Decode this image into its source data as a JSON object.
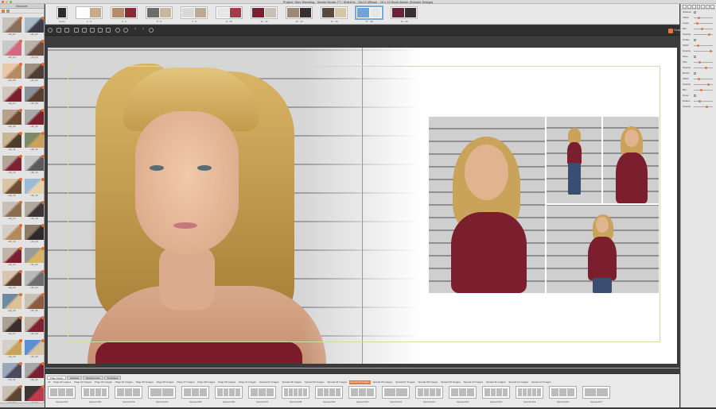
{
  "window": {
    "title": "Project: Wes Wedding - Senior Books TT / Shield A - 10x13 MBook - 10 x 10 Book Album (Sample Design)"
  },
  "browser": {
    "title": "Browser",
    "footer": "",
    "thumbs": [
      {
        "label": "Hill_01",
        "c1": "#c9c2bb",
        "c2": "#8a6e5a"
      },
      {
        "label": "Hill_02",
        "c1": "#a7b8c6",
        "c2": "#3d3b48"
      },
      {
        "label": "Hill_03",
        "c1": "#c8c8c8",
        "c2": "#d26a7f"
      },
      {
        "label": "Hill_04",
        "c1": "#b9b2a9",
        "c2": "#6a4c3e"
      },
      {
        "label": "Hill_05",
        "c1": "#e8c9ac",
        "c2": "#b78b62"
      },
      {
        "label": "Hill_06",
        "c1": "#9d8f82",
        "c2": "#4b3e36"
      },
      {
        "label": "Hill_07",
        "c1": "#cfc6bd",
        "c2": "#7b1f2e"
      },
      {
        "label": "Hill_08",
        "c1": "#8b8f99",
        "c2": "#5a3d2e"
      },
      {
        "label": "Hill_09",
        "c1": "#b6a18c",
        "c2": "#6b4a31"
      },
      {
        "label": "Hill_10",
        "c1": "#a8a8a8",
        "c2": "#7b1f2e"
      },
      {
        "label": "Hill_11",
        "c1": "#c9b496",
        "c2": "#4f3b2b"
      },
      {
        "label": "Hill_12",
        "c1": "#7c8a6a",
        "c2": "#c9a35a"
      },
      {
        "label": "Hill_13",
        "c1": "#b0a596",
        "c2": "#7d2233"
      },
      {
        "label": "Hill_14",
        "c1": "#c5c5c5",
        "c2": "#5b5b5b"
      },
      {
        "label": "Hill_15",
        "c1": "#d9c4a4",
        "c2": "#6d4d33"
      },
      {
        "label": "Hill_16",
        "c1": "#9cbbd9",
        "c2": "#e6d3a8"
      },
      {
        "label": "Hill_17",
        "c1": "#c7bfb5",
        "c2": "#8b6e4d"
      },
      {
        "label": "Hill_18",
        "c1": "#b2a99e",
        "c2": "#3d3436"
      },
      {
        "label": "Hill_19",
        "c1": "#d2cfc9",
        "c2": "#b48a5a"
      },
      {
        "label": "Hill_20",
        "c1": "#8c7a68",
        "c2": "#2f2a2a"
      },
      {
        "label": "Hill_21",
        "c1": "#c0b5a8",
        "c2": "#7b1f2e"
      },
      {
        "label": "Hill_22",
        "c1": "#9a9a9a",
        "c2": "#d8b466"
      },
      {
        "label": "Hill_23",
        "c1": "#d7c5ae",
        "c2": "#5e3b2c"
      },
      {
        "label": "Hill_24",
        "c1": "#b9b9b9",
        "c2": "#6d6d6d"
      },
      {
        "label": "Hill_25",
        "c1": "#6e8aa3",
        "c2": "#dcc292"
      },
      {
        "label": "Hill_26",
        "c1": "#c9c0b4",
        "c2": "#8a5c40"
      },
      {
        "label": "Hill_27",
        "c1": "#a9a194",
        "c2": "#3a2f2a"
      },
      {
        "label": "Hill_28",
        "c1": "#bfb3a4",
        "c2": "#7d2233"
      },
      {
        "label": "Hill_29",
        "c1": "#d4d0c8",
        "c2": "#c9a35a"
      },
      {
        "label": "Hill_30",
        "c1": "#5a8fd1",
        "c2": "#d9c3a0"
      },
      {
        "label": "Hill_31",
        "c1": "#9aa9b9",
        "c2": "#4a4a58"
      },
      {
        "label": "Hill_32",
        "c1": "#a7a7a7",
        "c2": "#7b1f2e"
      },
      {
        "label": "Hill_33",
        "c1": "#c9bfb1",
        "c2": "#5e4433"
      },
      {
        "label": "Hill_34",
        "c1": "#3d3436",
        "c2": "#c13a4a"
      }
    ]
  },
  "strip": {
    "spreads": [
      {
        "cap": "Cover",
        "pages": [
          "#2e2a2a"
        ],
        "w": 14
      },
      {
        "cap": "1 - 2",
        "pages": [
          "#ffffff",
          "#c9a98a"
        ],
        "w": 34
      },
      {
        "cap": "3 - 4",
        "pages": [
          "#b78b6a",
          "#8a2a36"
        ],
        "w": 34
      },
      {
        "cap": "5 - 6",
        "pages": [
          "#6d6d6d",
          "#c8b69d"
        ],
        "w": 34
      },
      {
        "cap": "7 - 8",
        "pages": [
          "#d9d9d9",
          "#b9a996"
        ],
        "w": 34
      },
      {
        "cap": "9 - 10",
        "pages": [
          "#e7e7e7",
          "#a23a4a"
        ],
        "w": 34
      },
      {
        "cap": "11 - 12",
        "pages": [
          "#7b1f2e",
          "#c9bfb5"
        ],
        "w": 34
      },
      {
        "cap": "13 - 14",
        "pages": [
          "#9b8877",
          "#3a3030"
        ],
        "w": 34
      },
      {
        "cap": "15 - 16",
        "pages": [
          "#5a4a3e",
          "#d4c4a8"
        ],
        "w": 34
      },
      {
        "cap": "17 - 18",
        "pages": [
          "#6ea3d9",
          "#e6e6e6"
        ],
        "w": 34
      },
      {
        "cap": "19 - 20",
        "pages": [
          "#6b2433",
          "#3a2f35"
        ],
        "w": 34
      }
    ]
  },
  "toolbar": {
    "right_label": "Share"
  },
  "bottom": {
    "tabs": [
      "Page Styles",
      "Spreads",
      "Backgrounds",
      "Templates"
    ],
    "filters": [
      "All",
      "Page 01 Images",
      "Page 02 Images",
      "Page 03 Images",
      "Page 04 Images",
      "Page 05 Images",
      "Page 06 Images",
      "Page 07 Images",
      "Page 08 Images",
      "Page 09 Images",
      "Page 10 Images",
      "Spread 01 Images",
      "Spread 02 Images",
      "Spread 03 Images",
      "Spread 04 Images",
      "Spread 05 Images",
      "Spread 06 Images",
      "Spread 07 Images",
      "Spread 08 Images",
      "Spread 09 Images",
      "Spread 10 Images",
      "Spread 11 Images",
      "Spread 12 Images",
      "Spread 13 Images"
    ],
    "active_filter_index": 15,
    "layouts": [
      {
        "cap": "Spread 001",
        "cells": 3
      },
      {
        "cap": "Spread 002",
        "cells": 4
      },
      {
        "cap": "Spread 003",
        "cells": 3
      },
      {
        "cap": "Spread 004",
        "cells": 2
      },
      {
        "cap": "Spread 005",
        "cells": 3
      },
      {
        "cap": "Spread 006",
        "cells": 4
      },
      {
        "cap": "Spread 007",
        "cells": 3
      },
      {
        "cap": "Spread 008",
        "cells": 5
      },
      {
        "cap": "Spread 009",
        "cells": 4
      },
      {
        "cap": "Spread 010",
        "cells": 3
      },
      {
        "cap": "Spread 011",
        "cells": 2
      },
      {
        "cap": "Spread 012",
        "cells": 4
      },
      {
        "cap": "Spread 013",
        "cells": 3
      },
      {
        "cap": "Spread 014",
        "cells": 4
      },
      {
        "cap": "Spread 015",
        "cells": 5
      },
      {
        "cap": "Spread 016",
        "cells": 3
      },
      {
        "cap": "Spread 017",
        "cells": 2
      }
    ]
  },
  "panel": {
    "rows": [
      "Shadow",
      "Offset",
      "Angle",
      "Blur",
      "Opacity",
      "Stroke",
      "Width",
      "Opacity",
      "Glow",
      "Size",
      "Opacity",
      "Border",
      "Width",
      "Opacity",
      "Blur",
      "Gloss",
      "Radius",
      "Opacity"
    ]
  }
}
